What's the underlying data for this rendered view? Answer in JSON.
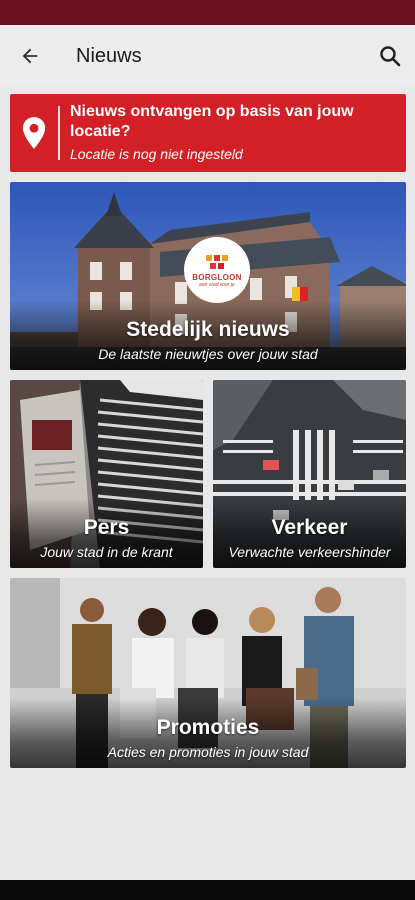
{
  "header": {
    "title": "Nieuws",
    "back_icon": "arrow-left-icon",
    "search_icon": "search-icon"
  },
  "location_banner": {
    "icon": "location-pin-icon",
    "title": "Nieuws ontvangen op basis van jouw locatie?",
    "subtitle": "Locatie is nog niet ingesteld",
    "color": "#d31f26"
  },
  "logo": {
    "name": "BORGLOON",
    "tagline": "een stad voor je"
  },
  "tiles": [
    {
      "title": "Stedelijk nieuws",
      "subtitle": "De laatste nieuwtjes over jouw stad"
    },
    {
      "title": "Pers",
      "subtitle": "Jouw stad in de krant"
    },
    {
      "title": "Verkeer",
      "subtitle": "Verwachte verkeershinder"
    },
    {
      "title": "Promoties",
      "subtitle": "Acties en promoties in jouw stad"
    }
  ],
  "colors": {
    "status_bar": "#6b1020",
    "accent": "#d31f26",
    "background": "#e8e8e8"
  }
}
